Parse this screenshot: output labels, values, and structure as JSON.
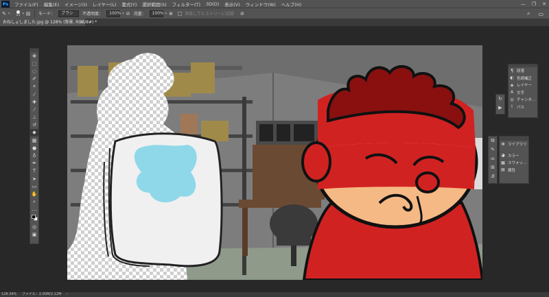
{
  "app": {
    "logo": "Ps"
  },
  "menu": {
    "items": [
      "ファイル(F)",
      "編集(E)",
      "イメージ(I)",
      "レイヤー(L)",
      "書式(Y)",
      "選択範囲(S)",
      "フィルター(T)",
      "3D(D)",
      "表示(V)",
      "ウィンドウ(W)",
      "ヘルプ(H)"
    ]
  },
  "window_controls": {
    "minimize": "—",
    "restore": "❐",
    "close": "✕"
  },
  "options": {
    "brush_size": "25",
    "mode_label": "モード：",
    "mode_value": "ブラシ",
    "opacity_label": "不透明度：",
    "opacity_value": "100%",
    "flow_label": "流量：",
    "flow_value": "100%",
    "history_label": "消去してヒストリーに記録"
  },
  "document": {
    "tab_title": "おねしょしました.jpg @ 128% (背景, RGB/8#) *",
    "close": "×"
  },
  "tools": {
    "icons": [
      "move-icon",
      "marquee-icon",
      "lasso-icon",
      "quick-select-icon",
      "crop-icon",
      "eyedropper-icon",
      "healing-icon",
      "brush-icon",
      "stamp-icon",
      "history-brush-icon",
      "eraser-icon",
      "gradient-icon",
      "blur-icon",
      "dodge-icon",
      "pen-icon",
      "type-icon",
      "path-select-icon",
      "shape-icon",
      "hand-icon",
      "zoom-icon",
      "more-icon"
    ]
  },
  "panels": {
    "group1": [
      "段落",
      "色調補正",
      "レイヤー",
      "文字",
      "チャンネ...",
      "パス"
    ],
    "group2": [
      "ライブラリ",
      "カラー",
      "スウォッ...",
      "属性"
    ]
  },
  "status": {
    "zoom": "128.34%",
    "file_info": "ファイル：2.00M/2.12M"
  }
}
